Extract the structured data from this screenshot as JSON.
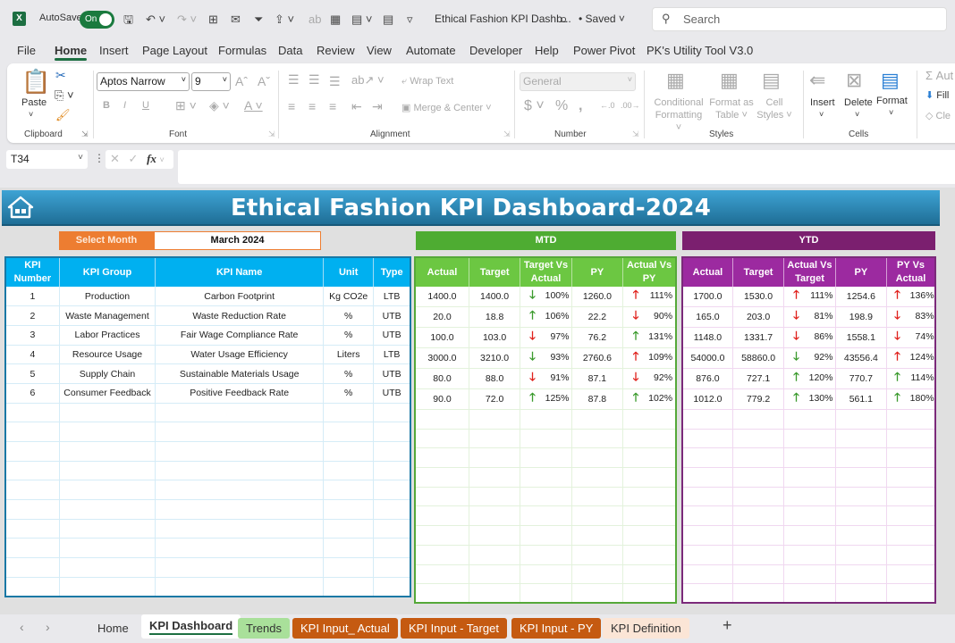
{
  "titlebar": {
    "app_icon": "excel-icon",
    "autosave_label": "AutoSave",
    "autosave_state": "On",
    "document_title": "Ethical Fashion KPI Dashb...",
    "save_status": "• Saved",
    "search_placeholder": "Search"
  },
  "menu": [
    "File",
    "Home",
    "Insert",
    "Page Layout",
    "Formulas",
    "Data",
    "Review",
    "View",
    "Automate",
    "Developer",
    "Help",
    "Power Pivot",
    "PK's Utility Tool V3.0"
  ],
  "menu_active": "Home",
  "ribbon": {
    "clipboard": {
      "paste": "Paste",
      "label": "Clipboard"
    },
    "font": {
      "font_name": "Aptos Narrow",
      "font_size": "9",
      "label": "Font",
      "bold": "B",
      "italic": "I",
      "underline": "U"
    },
    "alignment": {
      "wrap_text": "Wrap Text",
      "merge_center": "Merge & Center",
      "label": "Alignment"
    },
    "number": {
      "format": "General",
      "label": "Number"
    },
    "styles": {
      "conditional_formatting": [
        "Conditional",
        "Formatting"
      ],
      "format_as_table": [
        "Format as",
        "Table"
      ],
      "cell_styles": [
        "Cell",
        "Styles"
      ],
      "label": "Styles"
    },
    "cells": {
      "insert": "Insert",
      "delete": "Delete",
      "format": "Format",
      "label": "Cells"
    },
    "editing": {
      "autosum": "Aut",
      "fill": "Fill",
      "clear": "Cle"
    }
  },
  "formula_bar": {
    "name_box": "T34",
    "fx": "fx",
    "formula": ""
  },
  "dashboard": {
    "title": "Ethical Fashion KPI Dashboard-2024",
    "select_month_label": "Select Month",
    "selected_month": "March 2024",
    "mtd_label": "MTD",
    "ytd_label": "YTD",
    "kpi_headers": [
      [
        "KPI",
        "Number"
      ],
      [
        "KPI Group"
      ],
      [
        "KPI Name"
      ],
      [
        "Unit"
      ],
      [
        "Type"
      ]
    ],
    "mtd_headers": [
      [
        "Actual"
      ],
      [
        "Target"
      ],
      [
        "Target Vs",
        "Actual"
      ],
      [
        "PY"
      ],
      [
        "Actual Vs",
        "PY"
      ]
    ],
    "ytd_headers": [
      [
        "Actual"
      ],
      [
        "Target"
      ],
      [
        "Actual Vs",
        "Target"
      ],
      [
        "PY"
      ],
      [
        "PY Vs",
        "Actual"
      ]
    ],
    "colors": {
      "up_green": "#3a9a2c",
      "down_red": "#e0201b",
      "mtd": "#4eac32",
      "ytd": "#7b1f6f",
      "kpi": "#00b0f0",
      "select": "#ed7d31"
    },
    "rows": [
      {
        "num": "1",
        "group": "Production",
        "name": "Carbon Footprint",
        "unit": "Kg CO2e",
        "type": "LTB",
        "mtd": {
          "actual": "1400.0",
          "target": "1400.0",
          "tva": {
            "dir": "down",
            "color": "green",
            "pct": "100%"
          },
          "py": "1260.0",
          "avp": {
            "dir": "up",
            "color": "red",
            "pct": "111%"
          }
        },
        "ytd": {
          "actual": "1700.0",
          "target": "1530.0",
          "avt": {
            "dir": "up",
            "color": "red",
            "pct": "111%"
          },
          "py": "1254.6",
          "pva": {
            "dir": "up",
            "color": "red",
            "pct": "136%"
          }
        }
      },
      {
        "num": "2",
        "group": "Waste Management",
        "name": "Waste Reduction Rate",
        "unit": "%",
        "type": "UTB",
        "mtd": {
          "actual": "20.0",
          "target": "18.8",
          "tva": {
            "dir": "up",
            "color": "green",
            "pct": "106%"
          },
          "py": "22.2",
          "avp": {
            "dir": "down",
            "color": "red",
            "pct": "90%"
          }
        },
        "ytd": {
          "actual": "165.0",
          "target": "203.0",
          "avt": {
            "dir": "down",
            "color": "red",
            "pct": "81%"
          },
          "py": "198.9",
          "pva": {
            "dir": "down",
            "color": "red",
            "pct": "83%"
          }
        }
      },
      {
        "num": "3",
        "group": "Labor Practices",
        "name": "Fair Wage Compliance Rate",
        "unit": "%",
        "type": "UTB",
        "mtd": {
          "actual": "100.0",
          "target": "103.0",
          "tva": {
            "dir": "down",
            "color": "red",
            "pct": "97%"
          },
          "py": "76.2",
          "avp": {
            "dir": "up",
            "color": "green",
            "pct": "131%"
          }
        },
        "ytd": {
          "actual": "1148.0",
          "target": "1331.7",
          "avt": {
            "dir": "down",
            "color": "red",
            "pct": "86%"
          },
          "py": "1558.1",
          "pva": {
            "dir": "down",
            "color": "red",
            "pct": "74%"
          }
        }
      },
      {
        "num": "4",
        "group": "Resource Usage",
        "name": "Water Usage Efficiency",
        "unit": "Liters",
        "type": "LTB",
        "mtd": {
          "actual": "3000.0",
          "target": "3210.0",
          "tva": {
            "dir": "down",
            "color": "green",
            "pct": "93%"
          },
          "py": "2760.6",
          "avp": {
            "dir": "up",
            "color": "red",
            "pct": "109%"
          }
        },
        "ytd": {
          "actual": "54000.0",
          "target": "58860.0",
          "avt": {
            "dir": "down",
            "color": "green",
            "pct": "92%"
          },
          "py": "43556.4",
          "pva": {
            "dir": "up",
            "color": "red",
            "pct": "124%"
          }
        }
      },
      {
        "num": "5",
        "group": "Supply Chain",
        "name": "Sustainable Materials Usage",
        "unit": "%",
        "type": "UTB",
        "mtd": {
          "actual": "80.0",
          "target": "88.0",
          "tva": {
            "dir": "down",
            "color": "red",
            "pct": "91%"
          },
          "py": "87.1",
          "avp": {
            "dir": "down",
            "color": "red",
            "pct": "92%"
          }
        },
        "ytd": {
          "actual": "876.0",
          "target": "727.1",
          "avt": {
            "dir": "up",
            "color": "green",
            "pct": "120%"
          },
          "py": "770.7",
          "pva": {
            "dir": "up",
            "color": "green",
            "pct": "114%"
          }
        }
      },
      {
        "num": "6",
        "group": "Consumer Feedback",
        "name": "Positive Feedback Rate",
        "unit": "%",
        "type": "UTB",
        "mtd": {
          "actual": "90.0",
          "target": "72.0",
          "tva": {
            "dir": "up",
            "color": "green",
            "pct": "125%"
          },
          "py": "87.8",
          "avp": {
            "dir": "up",
            "color": "green",
            "pct": "102%"
          }
        },
        "ytd": {
          "actual": "1012.0",
          "target": "779.2",
          "avt": {
            "dir": "up",
            "color": "green",
            "pct": "130%"
          },
          "py": "561.1",
          "pva": {
            "dir": "up",
            "color": "green",
            "pct": "180%"
          }
        }
      }
    ]
  },
  "sheet_tabs": [
    {
      "label": "Home",
      "style": "plain"
    },
    {
      "label": "KPI Dashboard",
      "style": "active"
    },
    {
      "label": "Trends",
      "style": "green"
    },
    {
      "label": "KPI Input_ Actual",
      "style": "orange"
    },
    {
      "label": "KPI Input - Target",
      "style": "orange"
    },
    {
      "label": "KPI Input - PY",
      "style": "orange"
    },
    {
      "label": "KPI Definition",
      "style": "peach"
    }
  ]
}
